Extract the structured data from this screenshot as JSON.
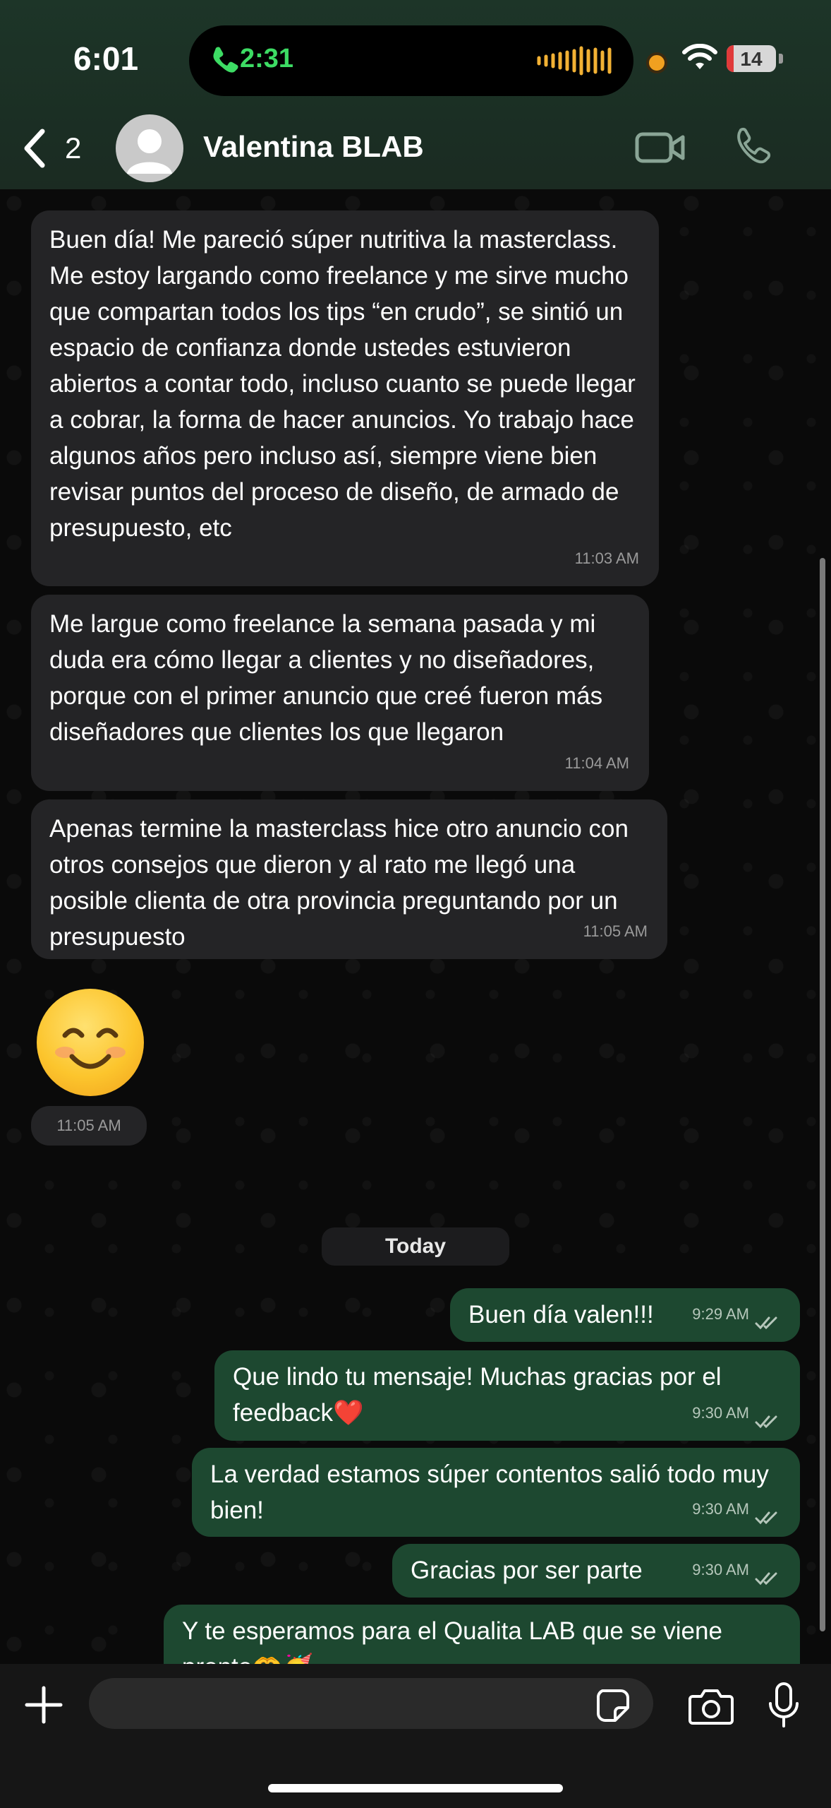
{
  "status_bar": {
    "time": "6:01",
    "call_timer": "2:31",
    "battery": "14",
    "battery_level": 0.14
  },
  "header": {
    "back_count": "2",
    "contact_name": "Valentina BLAB"
  },
  "messages_in": [
    {
      "text": "Buen día! Me pareció súper nutritiva la masterclass. Me estoy largando como freelance y me sirve mucho que compartan todos los tips “en crudo”, se sintió un espacio de confianza donde ustedes estuvieron abiertos a contar todo, incluso cuanto se puede llegar a cobrar, la forma de hacer anuncios. Yo trabajo hace algunos años pero incluso así, siempre viene bien revisar puntos del proceso de diseño, de armado de presupuesto, etc",
      "time": "11:03 AM"
    },
    {
      "text": "Me largue como freelance la semana pasada y mi duda era cómo llegar a clientes y no diseñadores, porque con el primer anuncio que creé fueron más diseñadores que clientes los que llegaron",
      "time": "11:04 AM"
    },
    {
      "text": "Apenas termine la masterclass hice otro anuncio con otros consejos que dieron y al rato me llegó una posible clienta de otra provincia preguntando por un presupuesto",
      "time": "11:05 AM"
    }
  ],
  "emoji_message": {
    "emoji": "😊",
    "time": "11:05 AM"
  },
  "day_separator": "Today",
  "messages_out": [
    {
      "text": "Buen día valen!!!",
      "time": "9:29 AM"
    },
    {
      "text": "Que lindo tu mensaje! Muchas gracias por el feedback❤️",
      "time": "9:30 AM"
    },
    {
      "text": "La verdad estamos súper contentos salió todo muy bien!",
      "time": "9:30 AM"
    },
    {
      "text": "Gracias por ser parte",
      "time": "9:30 AM"
    },
    {
      "text": "Y te esperamos para el Qualita LAB que se viene pronto🫶🥳",
      "time": ""
    }
  ],
  "input": {
    "placeholder": "",
    "value": ""
  },
  "icons": {
    "back": "chevron-left-icon",
    "video": "video-camera-icon",
    "call": "phone-icon",
    "plus": "plus-icon",
    "sticker": "sticker-icon",
    "camera": "camera-icon",
    "mic": "microphone-icon"
  },
  "colors": {
    "incoming_bubble": "#242426",
    "outgoing_bubble": "#1d4830",
    "call_green": "#3ddc64",
    "header_bg": "#1d3528"
  }
}
